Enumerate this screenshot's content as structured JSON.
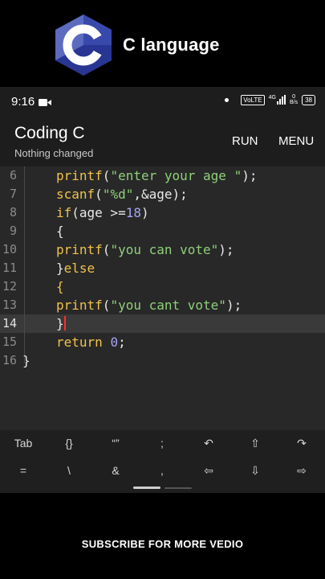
{
  "banner": {
    "title": "C language",
    "logo_letter": "C"
  },
  "status": {
    "time": "9:16",
    "network": "VoLTE",
    "net_type": "4G",
    "speed_top": "0",
    "speed_bottom": "B/s",
    "battery": "38"
  },
  "app": {
    "title": "Coding C",
    "subtitle": "Nothing changed",
    "run_label": "RUN",
    "menu_label": "MENU"
  },
  "editor": {
    "current_line": 14,
    "lines": [
      {
        "n": "6"
      },
      {
        "n": "7"
      },
      {
        "n": "8"
      },
      {
        "n": "9"
      },
      {
        "n": "10"
      },
      {
        "n": "11"
      },
      {
        "n": "12"
      },
      {
        "n": "13"
      },
      {
        "n": "14"
      },
      {
        "n": "15"
      },
      {
        "n": "16"
      }
    ],
    "tokens": {
      "l6a": "printf",
      "l6b": "(",
      "l6c": "\"enter your age \"",
      "l6d": ");",
      "l7a": "scanf",
      "l7b": "(",
      "l7c": "\"%d\"",
      "l7d": ",&age);",
      "l8a": "if",
      "l8b": "(age >=",
      "l8c": "18",
      "l8d": ")",
      "l9a": "{",
      "l10a": "printf",
      "l10b": "(",
      "l10c": "\"you can vote\"",
      "l10d": ");",
      "l11a": "}",
      "l11b": "else",
      "l12a": "{",
      "l13a": "printf",
      "l13b": "(",
      "l13c": "\"you cant vote\"",
      "l13d": ");",
      "l14a": "}",
      "l15a": "return",
      "l15b": " ",
      "l15c": "0",
      "l15d": ";",
      "l16a": "}"
    }
  },
  "keys": {
    "row1": [
      "Tab",
      "{}",
      "“”",
      ";",
      "↶",
      "⇧",
      "↷"
    ],
    "row2": [
      "=",
      "\\",
      "&",
      ",",
      "⇦",
      "⇩",
      "⇨"
    ]
  },
  "caption": "SUBSCRIBE FOR MORE VEDIO",
  "colors": {
    "keyword": "#f0c24a",
    "string": "#8fcf7a",
    "number": "#a7a3f5",
    "logo": "#3f51b5"
  }
}
